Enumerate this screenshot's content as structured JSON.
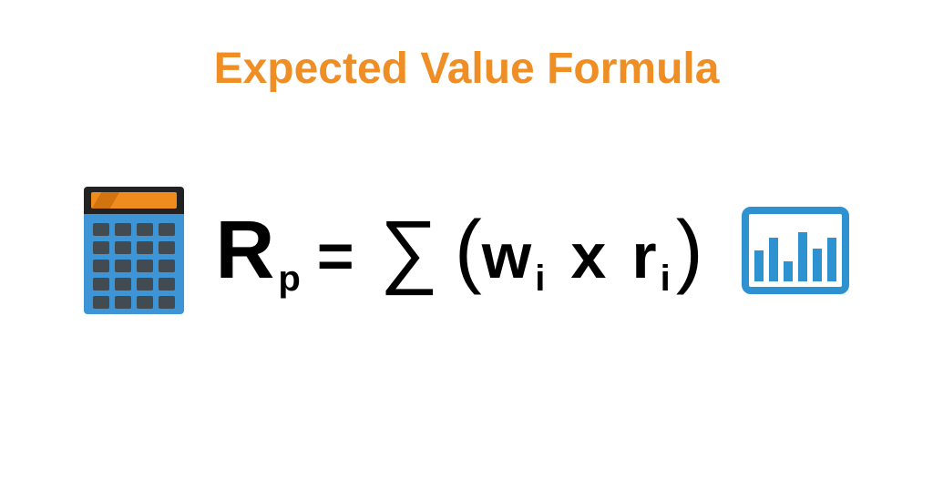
{
  "title": "Expected Value Formula",
  "formula": {
    "lhs_var": "R",
    "lhs_sub": "p",
    "eq": "=",
    "sum": "∑",
    "lp": "(",
    "term1": "w",
    "term1_sub": "i",
    "op": "x",
    "term2": "r",
    "term2_sub": "i",
    "rp": ")"
  },
  "icons": {
    "left": "calculator-icon",
    "right": "bar-chart-icon"
  },
  "colors": {
    "title": "#EE8E25",
    "formula": "#000000",
    "accent": "#2E92D0"
  }
}
